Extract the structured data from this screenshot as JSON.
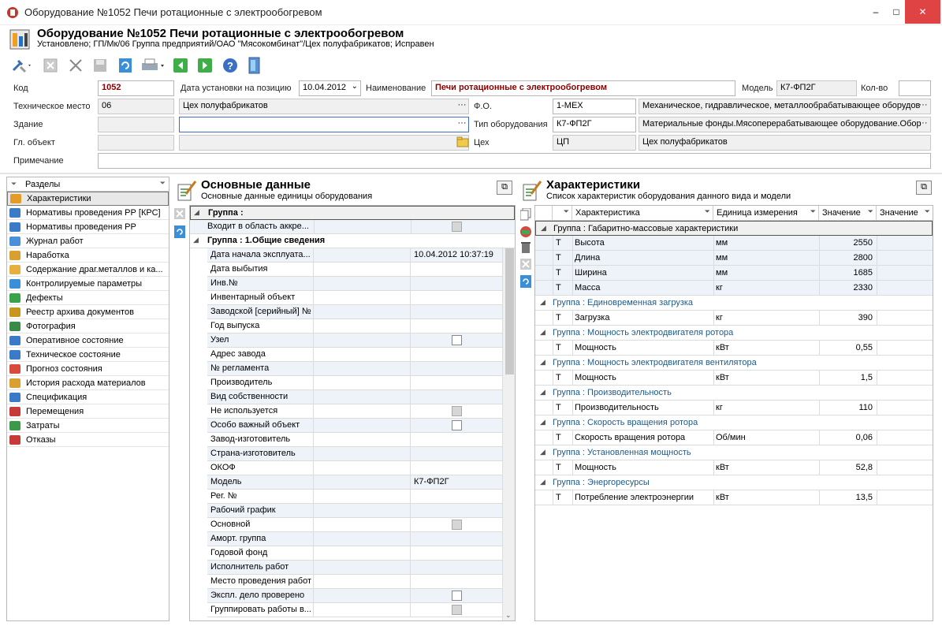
{
  "window": {
    "title": "Оборудование №1052 Печи ротационные с электрообогревом",
    "minimize": "–",
    "maximize": "□",
    "close": "✕"
  },
  "header": {
    "title": "Оборудование №1052 Печи ротационные с электрообогревом",
    "subtitle": "Установлено; ГП/Мк/06 Группа предприятий/ОАО \"Мясокомбинат\"/Цех полуфабрикатов; Исправен"
  },
  "toolbar": {
    "icons": [
      "tools-icon",
      "close-gray-icon",
      "cancel-icon",
      "save-icon",
      "refresh-icon",
      "print-icon",
      "back-icon",
      "forward-icon",
      "help-icon",
      "exit-icon"
    ]
  },
  "form": {
    "code_label": "Код",
    "code_value": "1052",
    "install_date_label": "Дата установки на позицию",
    "install_date_value": "10.04.2012",
    "name_label": "Наименование",
    "name_value": "Печи ротационные с электрообогревом",
    "model_label": "Модель",
    "model_value": "К7-ФП2Г",
    "qty_label": "Кол-во",
    "qty_value": "",
    "tech_place_label": "Техническое место",
    "tech_place_code": "06",
    "tech_place_name": "Цех полуфабрикатов",
    "fo_label": "Ф.О.",
    "fo_code": "1-МЕХ",
    "fo_name": "Механическое, гидравлическое, металлообрабатывающее оборудов",
    "building_label": "Здание",
    "building_code": "",
    "building_name": "",
    "equip_type_label": "Тип оборудования",
    "equip_type_code": "К7-ФП2Г",
    "equip_type_name": "Материальные фонды.Мясоперерабатывающее оборудование.Обор",
    "main_obj_label": "Гл. объект",
    "main_obj_code": "",
    "main_obj_name": "",
    "shop_label": "Цех",
    "shop_code": "ЦП",
    "shop_name": "Цех полуфабрикатов",
    "note_label": "Примечание",
    "note_value": "",
    "ellipsis": "···"
  },
  "sections": {
    "header": "Разделы",
    "items": [
      "Характеристики",
      "Нормативы проведения РР [КРС]",
      "Нормативы проведения РР",
      "Журнал работ",
      "Наработка",
      "Содержание драг.металлов и ка...",
      "Контролируемые параметры",
      "Дефекты",
      "Реестр архива документов",
      "Фотография",
      "Оперативное состояние",
      "Техническое состояние",
      "Прогноз состояния",
      "История расхода материалов",
      "Спецификация",
      "Перемещения",
      "Затраты",
      "Отказы"
    ]
  },
  "main_data": {
    "title": "Основные данные",
    "subtitle": "Основные данные единицы оборудования",
    "group_empty": "Группа :",
    "row_accr": "Входит в область аккре...",
    "group_general": "Группа : 1.Общие сведения",
    "rows": [
      {
        "label": "Дата начала эксплуата...",
        "value": "10.04.2012 10:37:19",
        "check": ""
      },
      {
        "label": "Дата выбытия",
        "value": "",
        "check": ""
      },
      {
        "label": "Инв.№",
        "value": "",
        "check": ""
      },
      {
        "label": "Инвентарный объект",
        "value": "",
        "check": ""
      },
      {
        "label": "Заводской [серийный] №",
        "value": "",
        "check": ""
      },
      {
        "label": "Год выпуска",
        "value": "",
        "check": ""
      },
      {
        "label": "Узел",
        "value": "",
        "check": "white"
      },
      {
        "label": "Адрес завода",
        "value": "",
        "check": ""
      },
      {
        "label": "№ регламента",
        "value": "",
        "check": ""
      },
      {
        "label": "Производитель",
        "value": "",
        "check": ""
      },
      {
        "label": "Вид собственности",
        "value": "",
        "check": ""
      },
      {
        "label": "Не используется",
        "value": "",
        "check": "gray"
      },
      {
        "label": "Особо важный объект",
        "value": "",
        "check": "white"
      },
      {
        "label": "Завод-изготовитель",
        "value": "",
        "check": ""
      },
      {
        "label": "Страна-изготовитель",
        "value": "",
        "check": ""
      },
      {
        "label": "ОКОФ",
        "value": "",
        "check": ""
      },
      {
        "label": "Модель",
        "value": "К7-ФП2Г",
        "check": ""
      },
      {
        "label": "Рег. №",
        "value": "",
        "check": ""
      },
      {
        "label": "Рабочий график",
        "value": "",
        "check": ""
      },
      {
        "label": "Основной",
        "value": "",
        "check": "gray"
      },
      {
        "label": "Аморт. группа",
        "value": "",
        "check": ""
      },
      {
        "label": "Годовой фонд",
        "value": "",
        "check": ""
      },
      {
        "label": "Исполнитель работ",
        "value": "",
        "check": ""
      },
      {
        "label": "Место проведения работ",
        "value": "",
        "check": ""
      },
      {
        "label": "Экспл. дело проверено",
        "value": "",
        "check": "white"
      },
      {
        "label": "Группировать работы в...",
        "value": "",
        "check": "gray"
      }
    ]
  },
  "characteristics": {
    "title": "Характеристики",
    "subtitle": "Список характеристик оборудования данного вида и модели",
    "columns": [
      "Характеристика",
      "Единица измерения",
      "Значение",
      "Значение"
    ],
    "groups": [
      {
        "name": "Группа : Габаритно-массовые характеристики",
        "rows": [
          {
            "t": "Т",
            "name": "Высота",
            "unit": "мм",
            "value": "2550"
          },
          {
            "t": "Т",
            "name": "Длина",
            "unit": "мм",
            "value": "2800"
          },
          {
            "t": "Т",
            "name": "Ширина",
            "unit": "мм",
            "value": "1685"
          },
          {
            "t": "Т",
            "name": "Масса",
            "unit": "кг",
            "value": "2330"
          }
        ]
      },
      {
        "name": "Группа : Единовременная загрузка",
        "rows": [
          {
            "t": "Т",
            "name": "Загрузка",
            "unit": "кг",
            "value": "390"
          }
        ]
      },
      {
        "name": "Группа : Мощность электродвигателя  ротора",
        "rows": [
          {
            "t": "Т",
            "name": "Мощность",
            "unit": "кВт",
            "value": "0,55"
          }
        ]
      },
      {
        "name": "Группа : Мощность электродвигателя вентилятора",
        "rows": [
          {
            "t": "Т",
            "name": "Мощность",
            "unit": "кВт",
            "value": "1,5"
          }
        ]
      },
      {
        "name": "Группа : Производительность",
        "rows": [
          {
            "t": "Т",
            "name": "Производительность",
            "unit": "кг",
            "value": "110"
          }
        ]
      },
      {
        "name": "Группа : Скорость вращения ротора",
        "rows": [
          {
            "t": "Т",
            "name": "Скорость вращения ротора",
            "unit": "Об/мин",
            "value": "0,06"
          }
        ]
      },
      {
        "name": "Группа : Установленная мощность",
        "rows": [
          {
            "t": "Т",
            "name": "Мощность",
            "unit": "кВт",
            "value": "52,8"
          }
        ]
      },
      {
        "name": "Группа : Энергоресурсы",
        "rows": [
          {
            "t": "Т",
            "name": "Потребление электроэнергии",
            "unit": "кВт",
            "value": "13,5"
          }
        ]
      }
    ]
  }
}
